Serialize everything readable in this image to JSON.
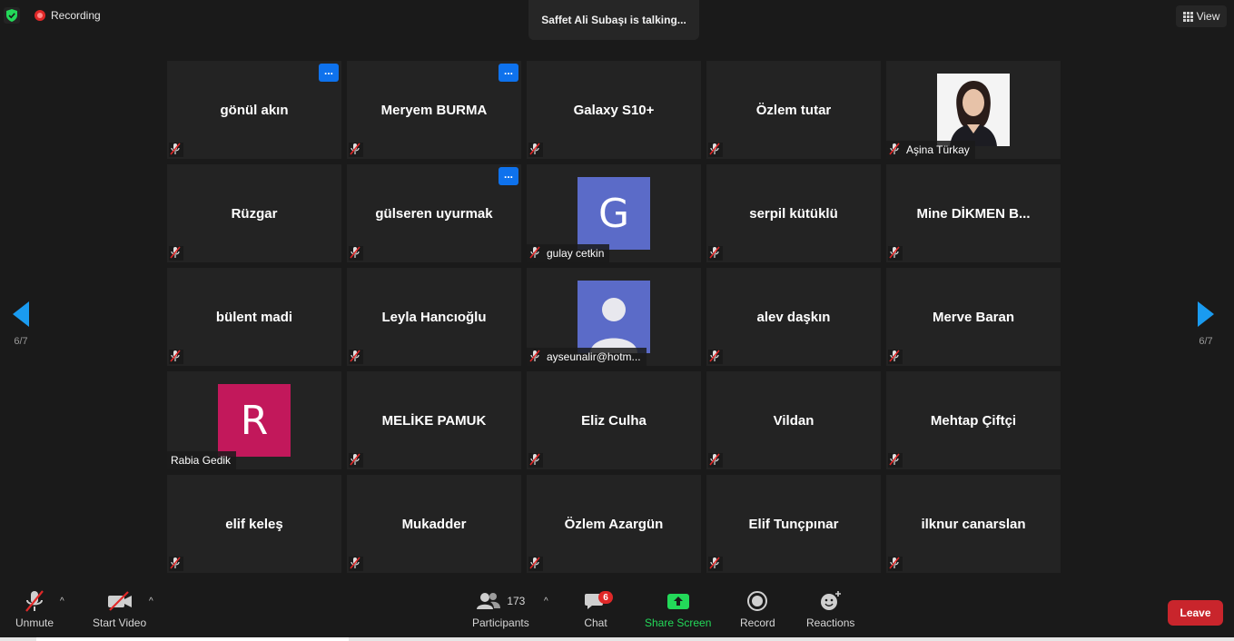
{
  "top": {
    "recording_label": "Recording",
    "talking": "Saffet Ali Subaşı is talking...",
    "view_label": "View"
  },
  "pagination": {
    "left": "6/7",
    "right": "6/7"
  },
  "colors": {
    "accent_blue": "#0e72ed",
    "leave_red": "#c9252c",
    "share_green": "#23d959",
    "avatar_g": "#5b6bc8",
    "avatar_r": "#c2185b"
  },
  "participants": [
    {
      "name": "gönül akın",
      "more": true
    },
    {
      "name": "Meryem BURMA",
      "more": true
    },
    {
      "name": "Galaxy S10+",
      "more": false
    },
    {
      "name": "Özlem tutar",
      "more": false
    },
    {
      "name": "Aşina Türkay",
      "more": false,
      "photo": true
    },
    {
      "name": "Rüzgar",
      "more": false
    },
    {
      "name": "gülseren uyurmak",
      "more": true
    },
    {
      "name": "gulay cetkin",
      "more": false,
      "avatar_letter": "G"
    },
    {
      "name": "serpil kütüklü",
      "more": false
    },
    {
      "name": "Mine DİKMEN B...",
      "more": false
    },
    {
      "name": "bülent madi",
      "more": false
    },
    {
      "name": "Leyla Hancıoğlu",
      "more": false
    },
    {
      "name": "ayseunalir@hotm...",
      "more": false,
      "avatar_generic": true
    },
    {
      "name": "alev daşkın",
      "more": false
    },
    {
      "name": "Merve Baran",
      "more": false
    },
    {
      "name": "Rabia Gedik",
      "more": false,
      "avatar_letter": "R"
    },
    {
      "name": "MELİKE PAMUK",
      "more": false
    },
    {
      "name": "Eliz Culha",
      "more": false
    },
    {
      "name": "Vildan",
      "more": false
    },
    {
      "name": "Mehtap Çiftçi",
      "more": false
    },
    {
      "name": "elif keleş",
      "more": false
    },
    {
      "name": "Mukadder",
      "more": false
    },
    {
      "name": "Özlem Azargün",
      "more": false
    },
    {
      "name": "Elif Tunçpınar",
      "more": false
    },
    {
      "name": "ilknur canarslan",
      "more": false
    }
  ],
  "toolbar": {
    "unmute": "Unmute",
    "start_video": "Start Video",
    "participants_label": "Participants",
    "participants_count": "173",
    "chat": "Chat",
    "chat_badge": "6",
    "share_screen": "Share Screen",
    "record": "Record",
    "reactions": "Reactions",
    "leave": "Leave"
  }
}
